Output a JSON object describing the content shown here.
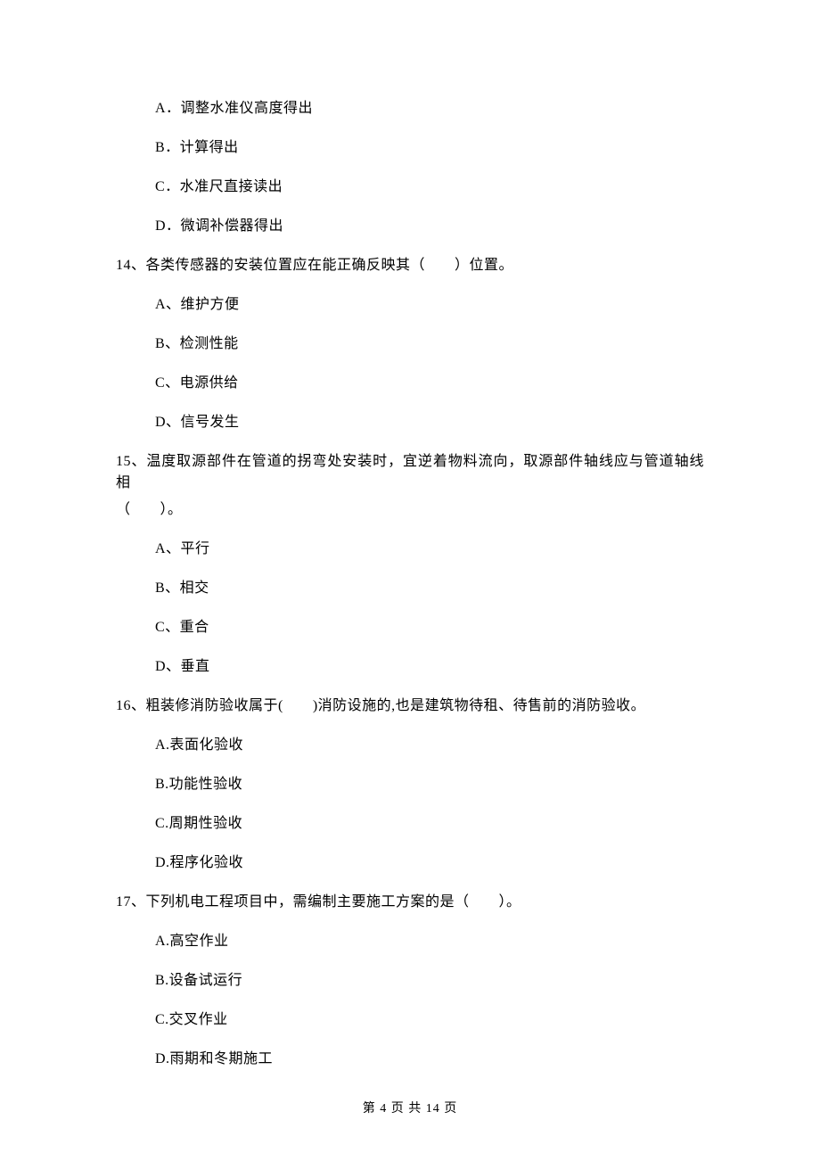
{
  "q13_continued_options": {
    "A": "A．调整水准仪高度得出",
    "B": "B．计算得出",
    "C": "C．水准尺直接读出",
    "D": "D．微调补偿器得出"
  },
  "q14": {
    "stem": "14、各类传感器的安装位置应在能正确反映其（　　）位置。",
    "options": {
      "A": "A、维护方便",
      "B": "B、检测性能",
      "C": "C、电源供给",
      "D": "D、信号发生"
    }
  },
  "q15": {
    "stem_line1": "15、温度取源部件在管道的拐弯处安装时，宜逆着物料流向，取源部件轴线应与管道轴线相",
    "stem_line2": "（　　）。",
    "options": {
      "A": "A、平行",
      "B": "B、相交",
      "C": "C、重合",
      "D": "D、垂直"
    }
  },
  "q16": {
    "stem": "16、粗装修消防验收属于(　　)消防设施的,也是建筑物待租、待售前的消防验收。",
    "options": {
      "A": "A.表面化验收",
      "B": "B.功能性验收",
      "C": "C.周期性验收",
      "D": "D.程序化验收"
    }
  },
  "q17": {
    "stem": "17、下列机电工程项目中，需编制主要施工方案的是（　　）。",
    "options": {
      "A": "A.高空作业",
      "B": "B.设备试运行",
      "C": "C.交叉作业",
      "D": "D.雨期和冬期施工"
    }
  },
  "footer": "第 4 页 共 14 页"
}
